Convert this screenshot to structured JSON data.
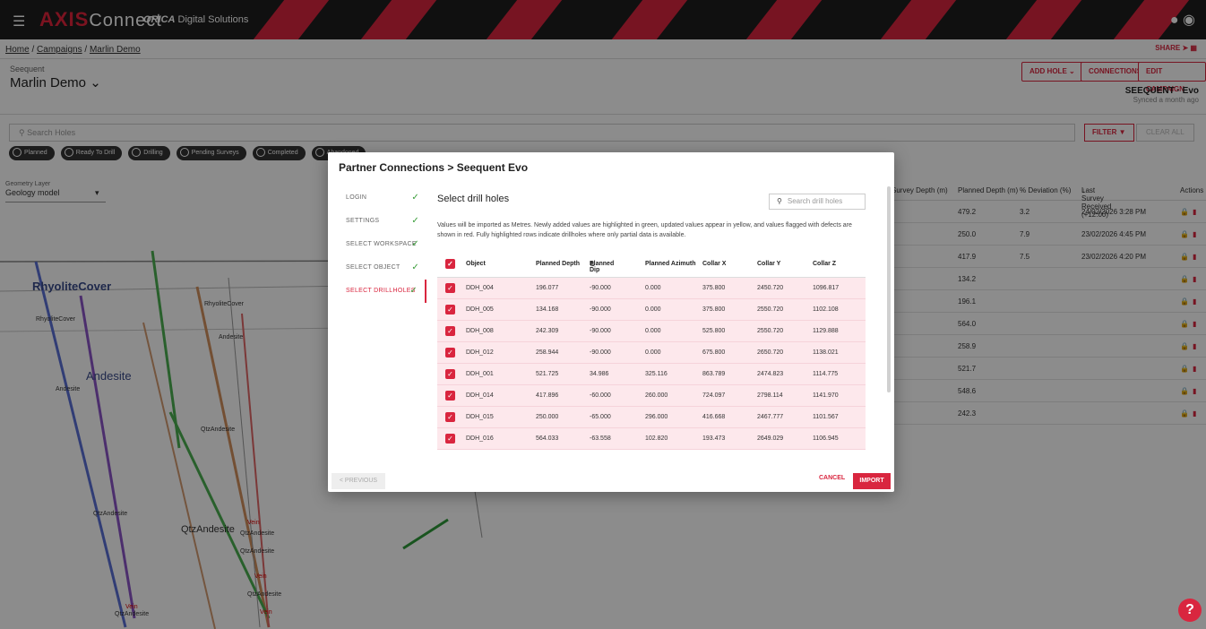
{
  "app": {
    "brand_axis": "AXIS",
    "brand_connect": "Connect",
    "brand_sup": "",
    "orica": "ORICA",
    "orica_sub": "Digital Solutions"
  },
  "breadcrumb": [
    "Home",
    "Campaigns",
    "Marlin Demo"
  ],
  "share_label": "SHARE",
  "header": {
    "subtitle": "Seequent",
    "title": "Marlin Demo",
    "buttons": [
      "ADD HOLE",
      "CONNECTIONS",
      "EDIT CAMPAIGN"
    ],
    "seequent_label": "SEEQUENT",
    "seequent_suffix": "Evo",
    "synced": "Synced a month ago"
  },
  "search": {
    "placeholder": "Search Holes",
    "filter_label": "FILTER",
    "clear_label": "CLEAR ALL"
  },
  "chips": [
    "Planned",
    "Ready To Drill",
    "Drilling",
    "Pending Surveys",
    "Completed",
    "Abandoned"
  ],
  "geometry": {
    "label": "Geometry Layer",
    "value": "Geology model"
  },
  "geo_labels": [
    {
      "text": "RhyoliteCover",
      "size": "big"
    },
    {
      "text": "RhyoliteCover",
      "size": "small"
    },
    {
      "text": "RhyoliteCover",
      "size": "small"
    },
    {
      "text": "Andesite",
      "size": "small"
    },
    {
      "text": "Andesite",
      "size": "big"
    },
    {
      "text": "Andesite",
      "size": "small"
    },
    {
      "text": "QtzAndesite",
      "size": "small"
    },
    {
      "text": "QtzAndesite",
      "size": "small"
    },
    {
      "text": "QtzAndesite",
      "size": "mid"
    },
    {
      "text": "Vein",
      "size": "red"
    },
    {
      "text": "QtzAndesite",
      "size": "small"
    },
    {
      "text": "QtzAndesite",
      "size": "small"
    },
    {
      "text": "Vein",
      "size": "red"
    },
    {
      "text": "QtzAndesite",
      "size": "small"
    },
    {
      "text": "Vein",
      "size": "red"
    },
    {
      "text": "QtzAndesite",
      "size": "small"
    },
    {
      "text": "Vein",
      "size": "red"
    }
  ],
  "right_table": {
    "headers": [
      "Survey Depth (m)",
      "Planned Depth (m)",
      "% Deviation (%)",
      "Last Survey Received (+12:00)",
      "Actions"
    ],
    "rows": [
      {
        "planned": "479.2",
        "dev": "3.2",
        "last": "24/02/2026 3:28 PM"
      },
      {
        "planned": "250.0",
        "dev": "7.9",
        "last": "23/02/2026 4:45 PM"
      },
      {
        "planned": "417.9",
        "dev": "7.5",
        "last": "23/02/2026 4:20 PM"
      },
      {
        "planned": "134.2",
        "dev": "",
        "last": ""
      },
      {
        "planned": "196.1",
        "dev": "",
        "last": ""
      },
      {
        "planned": "564.0",
        "dev": "",
        "last": ""
      },
      {
        "planned": "258.9",
        "dev": "",
        "last": ""
      },
      {
        "planned": "521.7",
        "dev": "",
        "last": ""
      },
      {
        "planned": "548.6",
        "dev": "",
        "last": ""
      },
      {
        "planned": "242.3",
        "dev": "",
        "last": ""
      }
    ]
  },
  "modal": {
    "title": "Partner Connections > Seequent Evo",
    "steps": [
      "LOGIN",
      "SETTINGS",
      "SELECT WORKSPACE",
      "SELECT OBJECT",
      "SELECT DRILLHOLES"
    ],
    "heading": "Select drill holes",
    "search_placeholder": "Search drill holes",
    "description": "Values will be imported as Metres. Newly added values are highlighted in green, updated values appear in yellow, and values flagged with defects are shown in red. Fully highlighted rows indicate drillholes where only partial data is available.",
    "columns": [
      "Object",
      "Planned Depth",
      "Planned Dip",
      "Planned Azimuth",
      "Collar X",
      "Collar Y",
      "Collar Z"
    ],
    "rows": [
      [
        "DDH_004",
        "196.077",
        "-90.000",
        "0.000",
        "375.800",
        "2450.720",
        "1096.817"
      ],
      [
        "DDH_005",
        "134.168",
        "-90.000",
        "0.000",
        "375.800",
        "2550.720",
        "1102.108"
      ],
      [
        "DDH_008",
        "242.309",
        "-90.000",
        "0.000",
        "525.800",
        "2550.720",
        "1129.888"
      ],
      [
        "DDH_012",
        "258.944",
        "-90.000",
        "0.000",
        "675.800",
        "2650.720",
        "1138.021"
      ],
      [
        "DDH_001",
        "521.725",
        "34.986",
        "325.116",
        "863.789",
        "2474.823",
        "1114.775"
      ],
      [
        "DDH_014",
        "417.896",
        "-60.000",
        "260.000",
        "724.097",
        "2798.114",
        "1141.970"
      ],
      [
        "DDH_015",
        "250.000",
        "-65.000",
        "296.000",
        "416.668",
        "2467.777",
        "1101.567"
      ],
      [
        "DDH_016",
        "564.033",
        "-63.558",
        "102.820",
        "193.473",
        "2649.029",
        "1106.945"
      ]
    ],
    "prev_label": "PREVIOUS",
    "cancel_label": "CANCEL",
    "import_label": "IMPORT"
  },
  "colors": {
    "accent": "#d9263f",
    "check": "#3a9d3a",
    "row_highlight": "#fde8ec"
  }
}
